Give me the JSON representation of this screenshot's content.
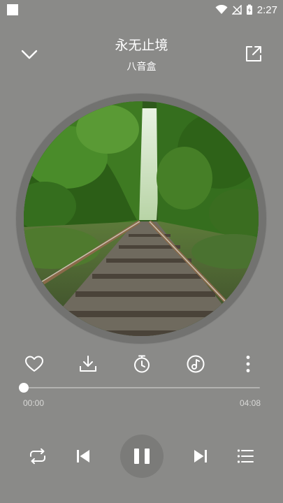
{
  "status_bar": {
    "time": "2:27"
  },
  "player": {
    "title": "永无止境",
    "artist": "八音盒",
    "current_time": "00:00",
    "total_time": "04:08",
    "progress_fraction": 0.0
  },
  "icons": {
    "collapse": "chevron-down-icon",
    "share": "share-icon",
    "like": "heart-icon",
    "download": "download-icon",
    "timer": "timer-icon",
    "sound_effect": "music-disc-icon",
    "more": "more-vertical-icon",
    "repeat": "repeat-icon",
    "previous": "skip-previous-icon",
    "pause": "pause-icon",
    "next": "skip-next-icon",
    "playlist": "playlist-icon"
  },
  "colors": {
    "background": "#8a8a88",
    "foreground": "#ffffff"
  }
}
